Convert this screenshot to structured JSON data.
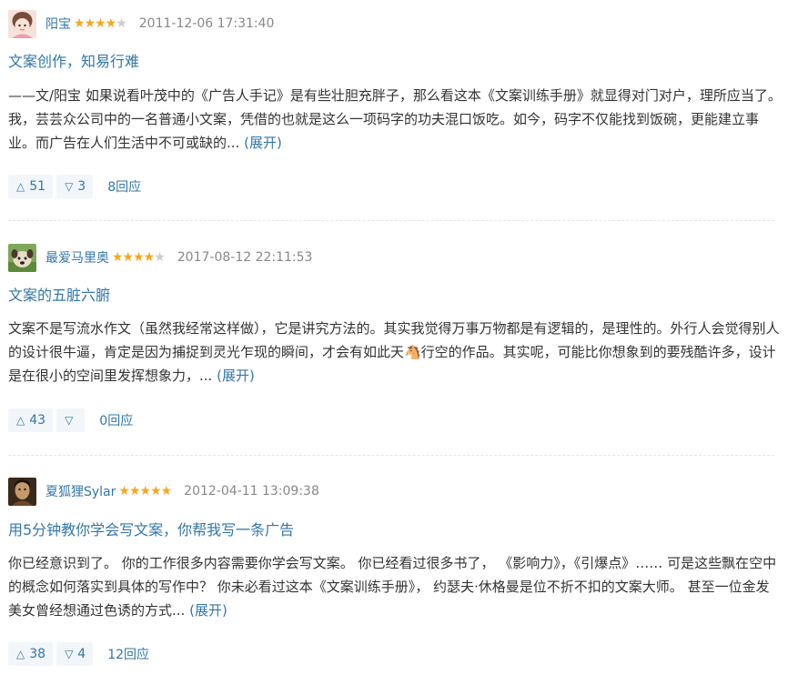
{
  "reviews": [
    {
      "user": "阳宝",
      "rating": 4,
      "stars_on": "★★★★",
      "stars_off": "★",
      "time": "2011-12-06 17:31:40",
      "title": "文案创作，知易行难",
      "body": "——文/阳宝 如果说看叶茂中的《广告人手记》是有些壮胆充胖子，那么看这本《文案训练手册》就显得对门对户，理所应当了。我，芸芸众公司中的一名普通小文案，凭借的也就是这么一项码字的功夫混口饭吃。如今，码字不仅能找到饭碗，更能建立事业。而广告在人们生活中不可或缺的...",
      "expand": "(展开)",
      "up": "51",
      "down": "3",
      "replies": "8回应"
    },
    {
      "user": "最爱马里奥",
      "rating": 4,
      "stars_on": "★★★★",
      "stars_off": "★",
      "time": "2017-08-12 22:11:53",
      "title": "文案的五脏六腑",
      "body": "文案不是写流水作文（虽然我经常这样做），它是讲究方法的。其实我觉得万事万物都是有逻辑的，是理性的。外行人会觉得别人的设计很牛逼，肯定是因为捕捉到灵光乍现的瞬间，才会有如此天🐴行空的作品。其实呢，可能比你想象到的要残酷许多，设计是在很小的空间里发挥想象力，...",
      "expand": "(展开)",
      "up": "43",
      "down": "",
      "replies": "0回应"
    },
    {
      "user": "夏狐狸Sylar",
      "rating": 5,
      "stars_on": "★★★★★",
      "stars_off": "",
      "time": "2012-04-11 13:09:38",
      "title": "用5分钟教你学会写文案，你帮我写一条广告",
      "body": "你已经意识到了。 你的工作很多内容需要你学会写文案。 你已经看过很多书了，  《影响力》，《引爆点》…… 可是这些飘在空中的概念如何落实到具体的写作中？ 你未必看过这本《文案训练手册》， 约瑟夫·休格曼是位不折不扣的文案大师。 甚至一位金发美女曾经想通过色诱的方式...",
      "expand": "(展开)",
      "up": "38",
      "down": "4",
      "replies": "12回应"
    }
  ],
  "colors": {
    "link": "#3377aa",
    "star": "#f6a623",
    "vote_bg": "#f2f6fa"
  },
  "icons": {
    "upvote": "triangle-up-icon",
    "downvote": "triangle-down-icon",
    "rating": "star-icon"
  }
}
